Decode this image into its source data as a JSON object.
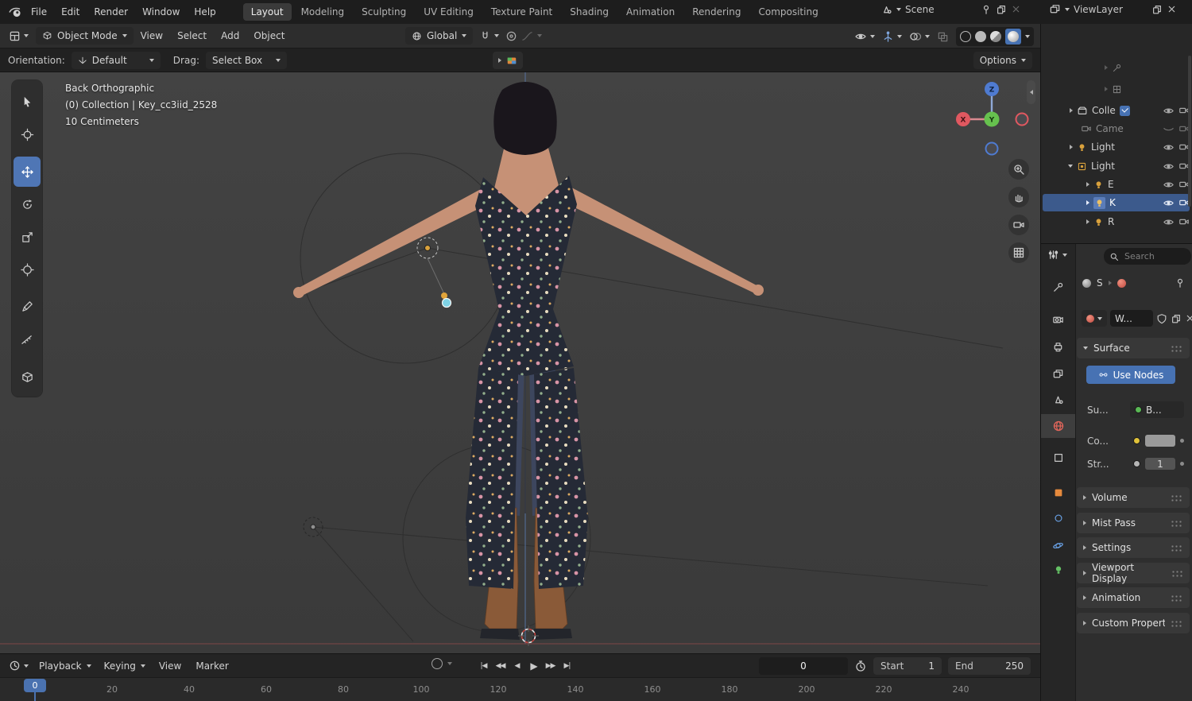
{
  "topbar": {
    "menus": [
      "File",
      "Edit",
      "Render",
      "Window",
      "Help"
    ],
    "workspaces": [
      "Layout",
      "Modeling",
      "Sculpting",
      "UV Editing",
      "Texture Paint",
      "Shading",
      "Animation",
      "Rendering",
      "Compositing"
    ],
    "active_workspace": "Layout",
    "scene": "Scene",
    "viewlayer": "ViewLayer"
  },
  "viewport_header": {
    "mode": "Object Mode",
    "menus": [
      "View",
      "Select",
      "Add",
      "Object"
    ],
    "orientation": "Global"
  },
  "tool_settings": {
    "orientation_label": "Orientation:",
    "orientation_value": "Default",
    "drag_label": "Drag:",
    "drag_value": "Select Box",
    "options": "Options"
  },
  "viewport": {
    "line1": "Back Orthographic",
    "line2": "(0) Collection | Key_cc3iid_2528",
    "line3": "10 Centimeters",
    "axis_x": "X",
    "axis_y": "Y",
    "axis_z": "Z"
  },
  "outliner": {
    "rows": [
      {
        "label": ""
      },
      {
        "label": ""
      },
      {
        "label": "Colle"
      },
      {
        "label": "Came"
      },
      {
        "label": "Light"
      },
      {
        "label": "Light"
      },
      {
        "label": "E"
      },
      {
        "label": "K"
      },
      {
        "label": "R"
      }
    ]
  },
  "properties": {
    "search_placeholder": "Search",
    "crumb_scene": "S",
    "world_name": "W...",
    "surface_title": "Surface",
    "use_nodes": "Use Nodes",
    "surface_label": "Su...",
    "surface_value": "B...",
    "color_label": "Co...",
    "strength_label": "Str...",
    "strength_value": "1",
    "panels": [
      "Volume",
      "Mist Pass",
      "Settings",
      "Viewport Display",
      "Animation",
      "Custom Properties"
    ]
  },
  "timeline": {
    "playback": "Playback",
    "keying": "Keying",
    "view": "View",
    "marker": "Marker",
    "transport": [
      "|◀",
      "◀◀",
      "◀",
      "▶",
      "▶▶",
      "▶|"
    ],
    "frame": "0",
    "start_label": "Start",
    "start_value": "1",
    "end_label": "End",
    "end_value": "250",
    "playhead": "0",
    "ticks": [
      "20",
      "40",
      "60",
      "80",
      "100",
      "120",
      "140",
      "160",
      "180",
      "200",
      "220",
      "240"
    ]
  },
  "colors": {
    "accent_blue": "#4772b3",
    "selection_blue": "#3c5a8c",
    "viewport_bg": "#3d3d3d",
    "light_icon_orange": "#d9a13c"
  }
}
